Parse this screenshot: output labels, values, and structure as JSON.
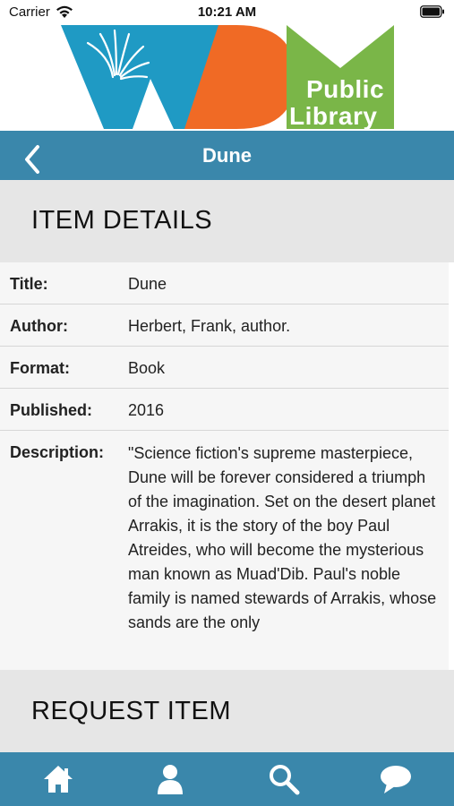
{
  "status_bar": {
    "carrier": "Carrier",
    "time": "10:21 AM"
  },
  "logo": {
    "line1": "Public",
    "line2": "Library",
    "colors": {
      "blue": "#1f9ac4",
      "orange": "#f06a25",
      "green": "#7ab648"
    }
  },
  "nav": {
    "title": "Dune",
    "back_icon": "chevron-left-icon",
    "bar_color": "#3a87ab"
  },
  "item_details": {
    "heading": "ITEM DETAILS",
    "rows": [
      {
        "label": "Title:",
        "value": "Dune"
      },
      {
        "label": "Author:",
        "value": "Herbert, Frank, author."
      },
      {
        "label": "Format:",
        "value": "Book"
      },
      {
        "label": "Published:",
        "value": "2016"
      }
    ],
    "description_label": "Description:",
    "description": "\"Science fiction's supreme masterpiece, Dune will be forever considered a triumph of the imagination. Set on the desert planet Arrakis, it is the story of the boy Paul Atreides, who will become the mysterious man known as Muad'Dib. Paul's noble family is named stewards of Arrakis, whose sands are the only"
  },
  "request": {
    "heading": "REQUEST ITEM"
  },
  "tab_bar": {
    "tabs": [
      {
        "icon": "home-icon"
      },
      {
        "icon": "person-icon"
      },
      {
        "icon": "search-icon"
      },
      {
        "icon": "chat-bubble-icon"
      }
    ]
  }
}
